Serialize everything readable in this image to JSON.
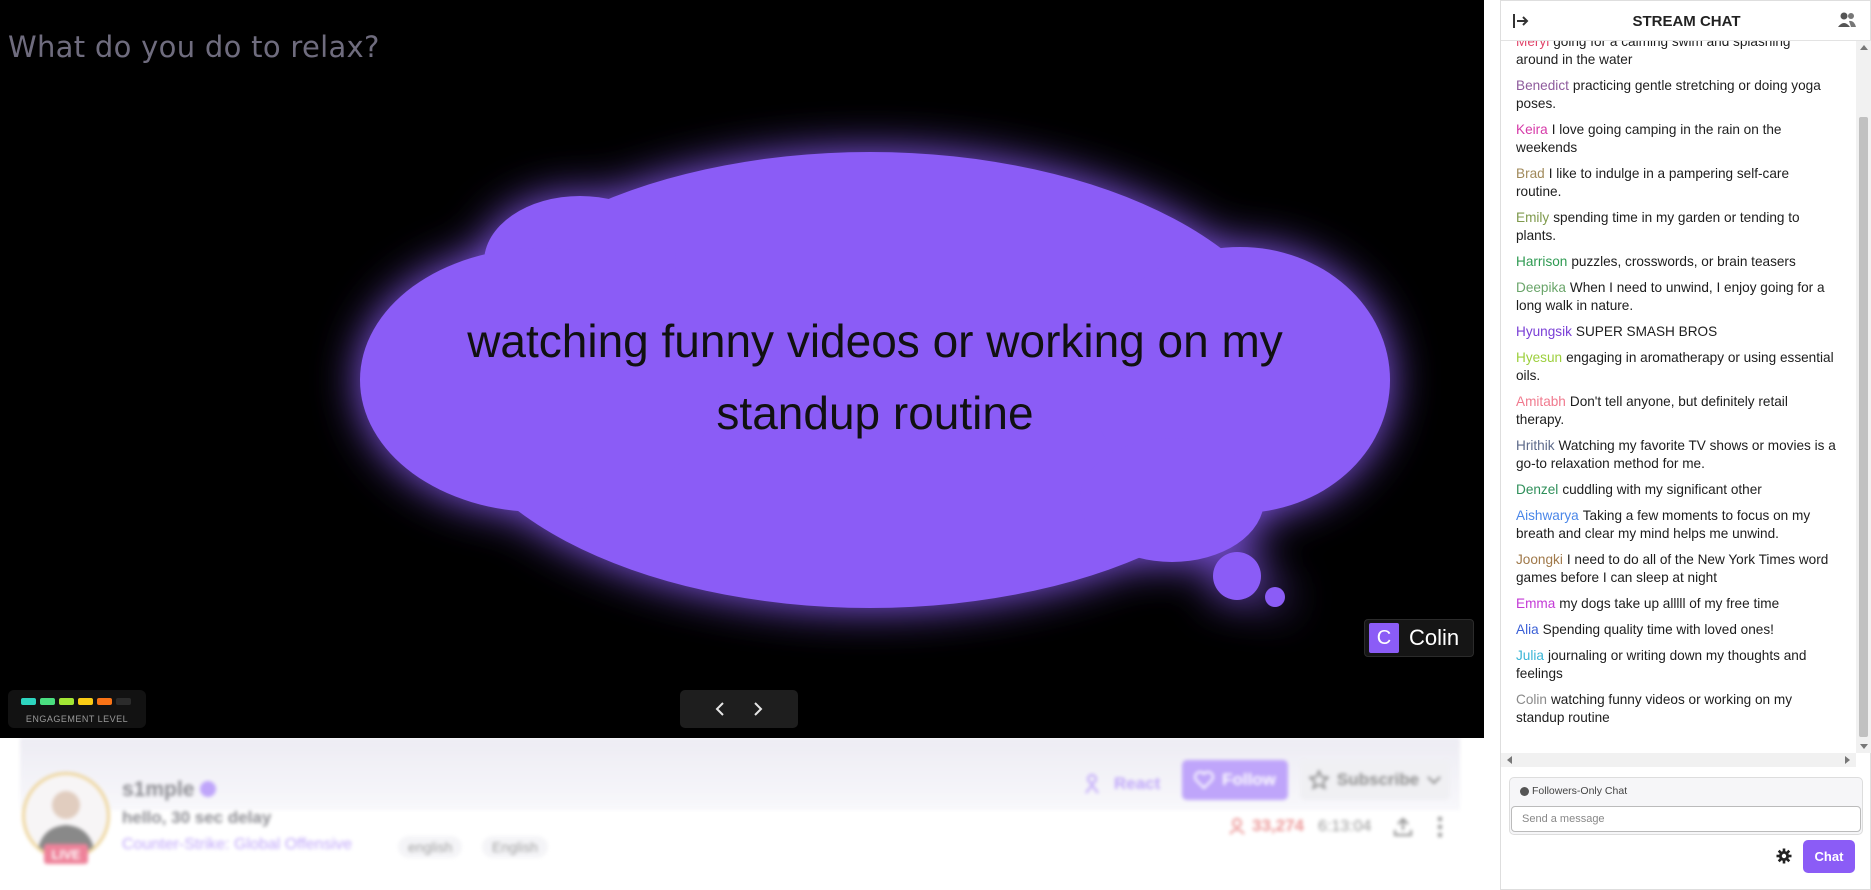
{
  "stage": {
    "prompt": "What do you do to relax?",
    "bubble_text": "watching funny videos or working on my standup routine",
    "author": {
      "initial": "C",
      "name": "Colin"
    },
    "engagement": {
      "label": "ENGAGEMENT LEVEL",
      "level": 5,
      "max": 6,
      "colors": [
        "#2dd4bf",
        "#4ade80",
        "#a3e635",
        "#facc15",
        "#f97316",
        "#2b2b2b"
      ]
    },
    "nav": {
      "prev_icon": "chevron-left-icon",
      "next_icon": "chevron-right-icon"
    }
  },
  "stream_info": {
    "live": "LIVE",
    "channel": "s1mple",
    "title": "hello, 30 sec delay",
    "game": "Counter-Strike: Global Offensive",
    "tags": [
      "english",
      "English"
    ],
    "react_label": "React",
    "follow_label": "Follow",
    "subscribe_label": "Subscribe",
    "viewers": "33,274",
    "uptime": "6:13:04"
  },
  "chat": {
    "title": "STREAM CHAT",
    "messages": [
      {
        "user": "Meryl",
        "color": "#e0456a",
        "text": "going for a calming swim and splashing around in the water"
      },
      {
        "user": "Benedict",
        "color": "#8e5a9c",
        "text": "practicing gentle stretching or doing yoga poses."
      },
      {
        "user": "Keira",
        "color": "#d63aa8",
        "text": "I love going camping in the rain on the weekends"
      },
      {
        "user": "Brad",
        "color": "#a0895a",
        "text": "I like to indulge in a pampering self-care routine."
      },
      {
        "user": "Emily",
        "color": "#7f9a4d",
        "text": "spending time in my garden or tending to plants."
      },
      {
        "user": "Harrison",
        "color": "#2f9a52",
        "text": "puzzles, crosswords, or brain teasers"
      },
      {
        "user": "Deepika",
        "color": "#6aa56a",
        "text": "When I need to unwind, I enjoy going for a long walk in nature."
      },
      {
        "user": "Hyungsik",
        "color": "#7a3fd6",
        "text": "SUPER SMASH BROS"
      },
      {
        "user": "Hyesun",
        "color": "#9ccf3c",
        "text": "engaging in aromatherapy or using essential oils."
      },
      {
        "user": "Amitabh",
        "color": "#f07a8e",
        "text": "Don't tell anyone, but definitely retail therapy."
      },
      {
        "user": "Hrithik",
        "color": "#5d6a8a",
        "text": "Watching my favorite TV shows or movies is a go-to relaxation method for me."
      },
      {
        "user": "Denzel",
        "color": "#2f8f5a",
        "text": "cuddling with my significant other"
      },
      {
        "user": "Aishwarya",
        "color": "#4a86e8",
        "text": "Taking a few moments to focus on my breath and clear my mind helps me unwind."
      },
      {
        "user": "Joongki",
        "color": "#a0794a",
        "text": "I need to do all of the New York Times word games before I can sleep at night"
      },
      {
        "user": "Emma",
        "color": "#c33ad6",
        "text": "my dogs take up alllll of my free time"
      },
      {
        "user": "Alia",
        "color": "#3a5fd6",
        "text": "Spending quality time with loved ones!"
      },
      {
        "user": "Julia",
        "color": "#3ab5d6",
        "text": "journaling or writing down my thoughts and feelings"
      },
      {
        "user": "Colin",
        "color": "#8a8a8a",
        "text": "watching funny videos or working on my standup routine"
      }
    ],
    "followers_only": "Followers-Only Chat",
    "input_placeholder": "Send a message",
    "send_label": "Chat"
  }
}
